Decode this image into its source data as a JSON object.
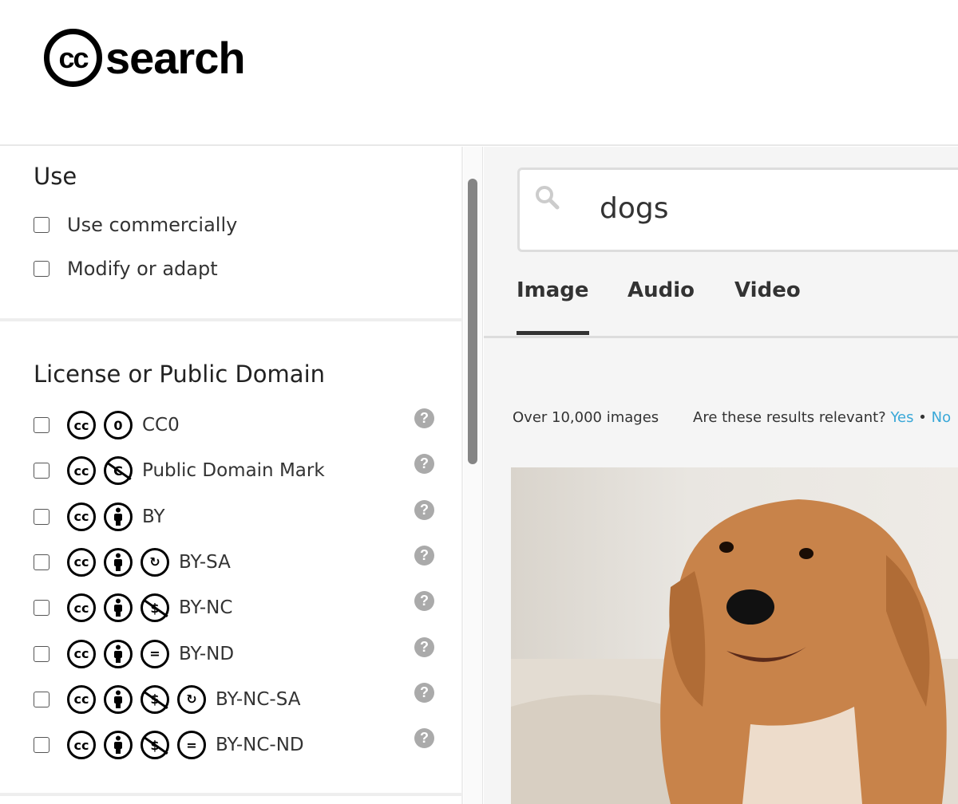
{
  "header": {
    "logo_cc": "cc",
    "logo_text": "search"
  },
  "sidebar": {
    "use": {
      "heading": "Use",
      "options": [
        {
          "label": "Use commercially",
          "checked": false
        },
        {
          "label": "Modify or adapt",
          "checked": false
        }
      ]
    },
    "license": {
      "heading": "License or Public Domain",
      "help": "?",
      "options": [
        {
          "label": "CC0",
          "icons": [
            "cc",
            "zero"
          ],
          "checked": false
        },
        {
          "label": "Public Domain Mark",
          "icons": [
            "cc",
            "pd"
          ],
          "checked": false
        },
        {
          "label": "BY",
          "icons": [
            "cc",
            "by"
          ],
          "checked": false
        },
        {
          "label": "BY-SA",
          "icons": [
            "cc",
            "by",
            "sa"
          ],
          "checked": false
        },
        {
          "label": "BY-NC",
          "icons": [
            "cc",
            "by",
            "nc"
          ],
          "checked": false
        },
        {
          "label": "BY-ND",
          "icons": [
            "cc",
            "by",
            "nd"
          ],
          "checked": false
        },
        {
          "label": "BY-NC-SA",
          "icons": [
            "cc",
            "by",
            "nc",
            "sa"
          ],
          "checked": false
        },
        {
          "label": "BY-NC-ND",
          "icons": [
            "cc",
            "by",
            "nc",
            "nd"
          ],
          "checked": false
        }
      ]
    }
  },
  "main": {
    "search": {
      "value": "dogs"
    },
    "tabs": [
      {
        "label": "Image",
        "active": true
      },
      {
        "label": "Audio",
        "active": false
      },
      {
        "label": "Video",
        "active": false
      }
    ],
    "result_count": "Over 10,000 images",
    "relevance": {
      "question": "Are these results relevant?",
      "yes": "Yes",
      "separator": "•",
      "no": "No"
    }
  },
  "colors": {
    "link": "#3aa8d8",
    "main_bg": "#f5f5f5",
    "scrollbar": "#858585"
  }
}
